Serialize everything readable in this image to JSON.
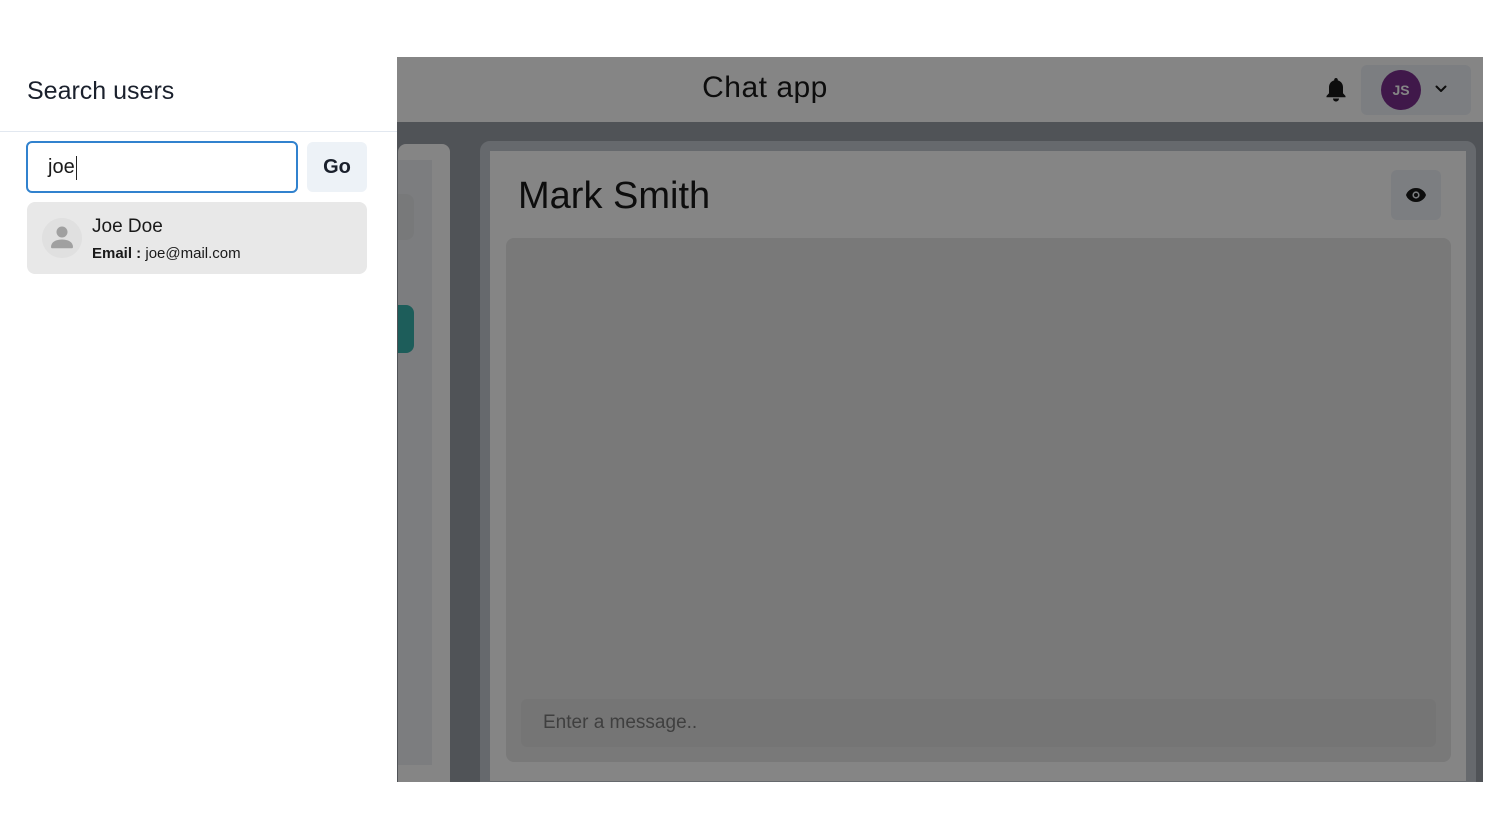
{
  "app": {
    "title": "Chat app",
    "user_initials": "JS",
    "chat_name": "Mark Smith",
    "message_placeholder": "Enter a message..",
    "colors": {
      "accent": "#38b2ac",
      "avatar": "#7b2f8f",
      "focus": "#3182ce"
    }
  },
  "drawer": {
    "title": "Search users",
    "search_value": "joe",
    "go_label": "Go",
    "results": [
      {
        "name": "Joe Doe",
        "email_label": "Email :",
        "email": "joe@mail.com"
      }
    ]
  },
  "icons": [
    "bell-icon",
    "chevron-down-icon",
    "eye-icon",
    "user-avatar-icon"
  ]
}
